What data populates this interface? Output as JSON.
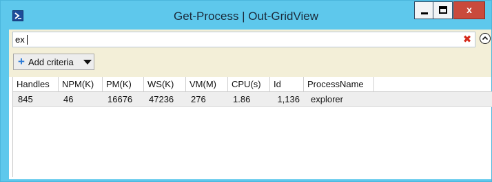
{
  "window": {
    "title": "Get-Process | Out-GridView",
    "controls": {
      "minimize": "minimize",
      "maximize": "maximize",
      "close": "x"
    }
  },
  "filter": {
    "query": "ex",
    "clear_icon": "✖",
    "add_criteria_label": "Add criteria"
  },
  "grid": {
    "columns": [
      "Handles",
      "NPM(K)",
      "PM(K)",
      "WS(K)",
      "VM(M)",
      "CPU(s)",
      "Id",
      "ProcessName"
    ],
    "rows": [
      {
        "Handles": "845",
        "NPM(K)": "46",
        "PM(K)": "16676",
        "WS(K)": "47236",
        "VM(M)": "276",
        "CPU(s)": "1.86",
        "Id": "1,136",
        "ProcessName": "explorer"
      }
    ]
  },
  "colors": {
    "titlebar": "#5ec8ec",
    "filter_panel": "#f3efd8",
    "selected_row": "#eeeeee",
    "close_button": "#c94a3c"
  },
  "icons": [
    "powershell-icon",
    "minimize-icon",
    "maximize-icon",
    "close-icon",
    "clear-search-icon",
    "collapse-icon",
    "plus-icon",
    "dropdown-arrow-icon"
  ]
}
